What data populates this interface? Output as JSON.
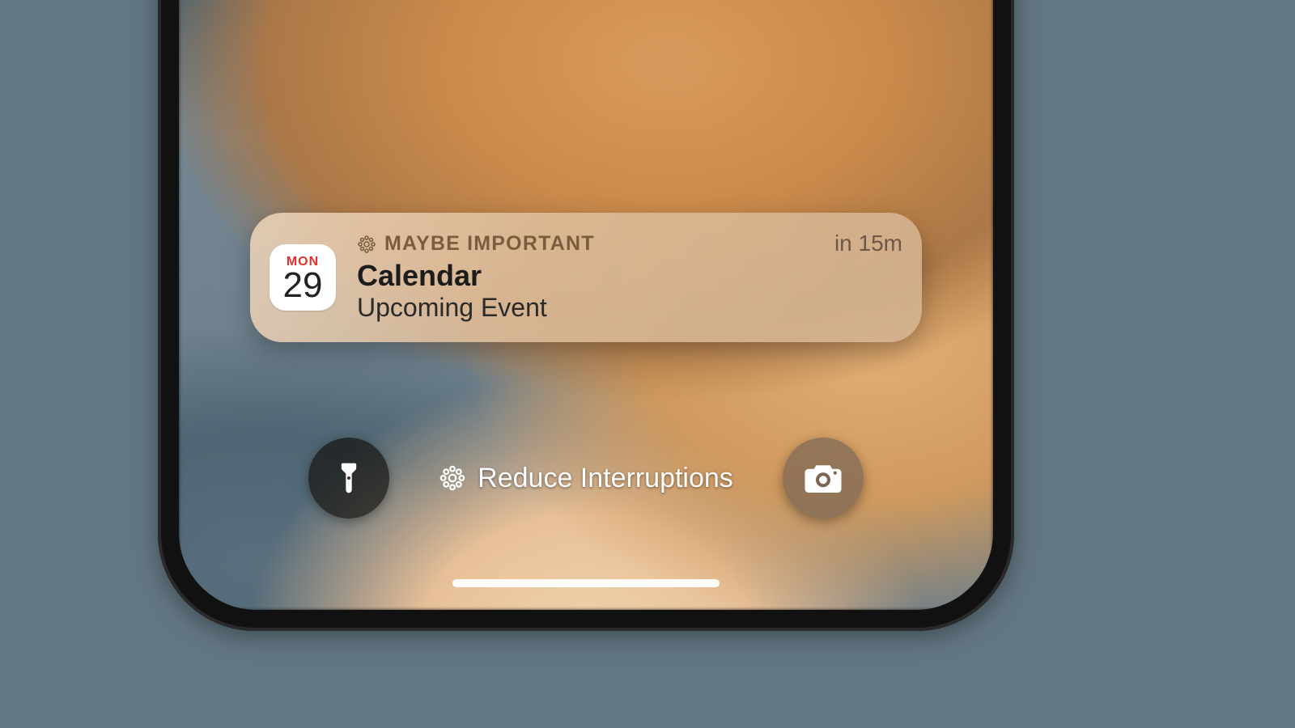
{
  "notification": {
    "tag_label": "MAYBE IMPORTANT",
    "app_name": "Calendar",
    "subtitle": "Upcoming Event",
    "time": "in 15m",
    "icon": {
      "day_of_week": "MON",
      "date": "29"
    }
  },
  "focus": {
    "label": "Reduce Interruptions"
  },
  "colors": {
    "page_bg": "#637783",
    "tag_text": "#7a5c3e",
    "cal_dow": "#e0332b"
  }
}
